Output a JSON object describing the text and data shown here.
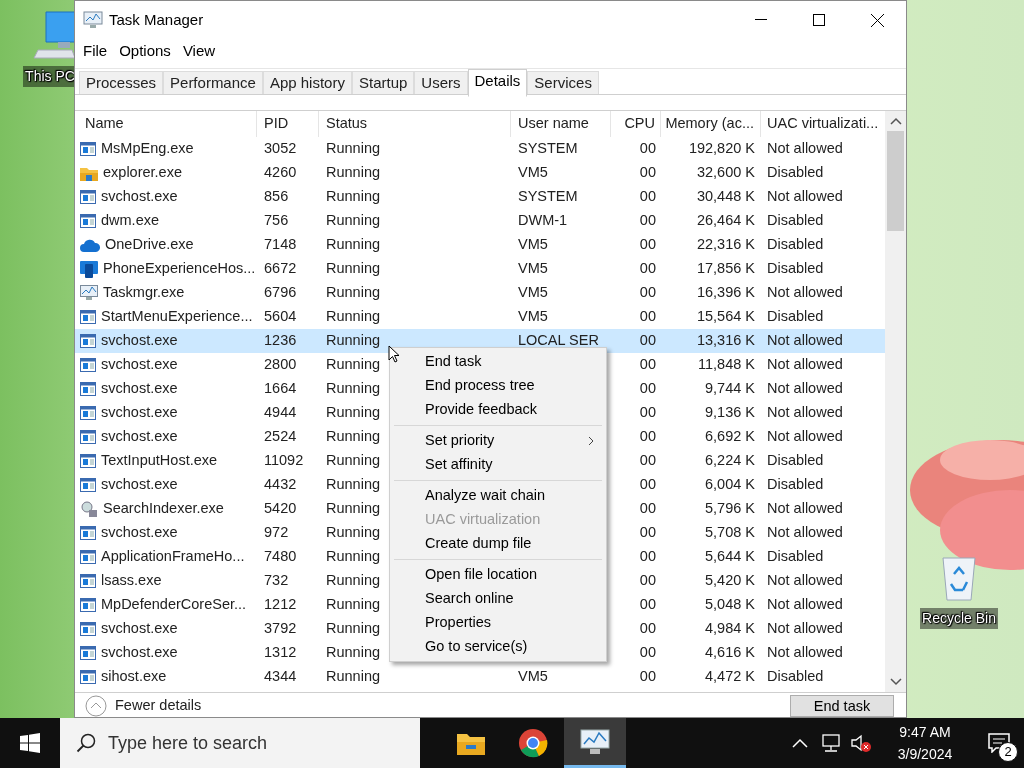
{
  "desktop_icons": [
    {
      "label": "This PC",
      "kind": "computer"
    },
    {
      "label": "Recycle Bin",
      "kind": "bin"
    }
  ],
  "window": {
    "title": "Task Manager"
  },
  "menu_bar": [
    "File",
    "Options",
    "View"
  ],
  "tabs": [
    {
      "label": "Processes",
      "selected": false
    },
    {
      "label": "Performance",
      "selected": false
    },
    {
      "label": "App history",
      "selected": false
    },
    {
      "label": "Startup",
      "selected": false
    },
    {
      "label": "Users",
      "selected": false
    },
    {
      "label": "Details",
      "selected": true
    },
    {
      "label": "Services",
      "selected": false
    }
  ],
  "table": {
    "columns": [
      "Name",
      "PID",
      "Status",
      "User name",
      "CPU",
      "Memory (ac...",
      "UAC virtualizati..."
    ],
    "rows": [
      {
        "kind": "app",
        "name": "MsMpEng.exe",
        "pid": "3052",
        "status": "Running",
        "user": "SYSTEM",
        "cpu": "00",
        "memory": "192,820 K",
        "uac": "Not allowed",
        "selected": false
      },
      {
        "kind": "folder",
        "name": "explorer.exe",
        "pid": "4260",
        "status": "Running",
        "user": "VM5",
        "cpu": "00",
        "memory": "32,600 K",
        "uac": "Disabled",
        "selected": false
      },
      {
        "kind": "app",
        "name": "svchost.exe",
        "pid": "856",
        "status": "Running",
        "user": "SYSTEM",
        "cpu": "00",
        "memory": "30,448 K",
        "uac": "Not allowed",
        "selected": false
      },
      {
        "kind": "app",
        "name": "dwm.exe",
        "pid": "756",
        "status": "Running",
        "user": "DWM-1",
        "cpu": "00",
        "memory": "26,464 K",
        "uac": "Disabled",
        "selected": false
      },
      {
        "kind": "cloud",
        "name": "OneDrive.exe",
        "pid": "7148",
        "status": "Running",
        "user": "VM5",
        "cpu": "00",
        "memory": "22,316 K",
        "uac": "Disabled",
        "selected": false
      },
      {
        "kind": "phone",
        "name": "PhoneExperienceHos...",
        "pid": "6672",
        "status": "Running",
        "user": "VM5",
        "cpu": "00",
        "memory": "17,856 K",
        "uac": "Disabled",
        "selected": false
      },
      {
        "kind": "monitor",
        "name": "Taskmgr.exe",
        "pid": "6796",
        "status": "Running",
        "user": "VM5",
        "cpu": "00",
        "memory": "16,396 K",
        "uac": "Not allowed",
        "selected": false
      },
      {
        "kind": "app",
        "name": "StartMenuExperience...",
        "pid": "5604",
        "status": "Running",
        "user": "VM5",
        "cpu": "00",
        "memory": "15,564 K",
        "uac": "Disabled",
        "selected": false
      },
      {
        "kind": "app",
        "name": "svchost.exe",
        "pid": "1236",
        "status": "Running",
        "user": "LOCAL SER",
        "cpu": "00",
        "memory": "13,316 K",
        "uac": "Not allowed",
        "selected": true
      },
      {
        "kind": "app",
        "name": "svchost.exe",
        "pid": "2800",
        "status": "Running",
        "cpu": "00",
        "memory": "11,848 K",
        "uac": "Not allowed",
        "selected": false
      },
      {
        "kind": "app",
        "name": "svchost.exe",
        "pid": "1664",
        "status": "Running",
        "cpu": "00",
        "memory": "9,744 K",
        "uac": "Not allowed",
        "selected": false
      },
      {
        "kind": "app",
        "name": "svchost.exe",
        "pid": "4944",
        "status": "Running",
        "cpu": "00",
        "memory": "9,136 K",
        "uac": "Not allowed",
        "selected": false
      },
      {
        "kind": "app",
        "name": "svchost.exe",
        "pid": "2524",
        "status": "Running",
        "cpu": "00",
        "memory": "6,692 K",
        "uac": "Not allowed",
        "selected": false
      },
      {
        "kind": "app",
        "name": "TextInputHost.exe",
        "pid": "11092",
        "status": "Running",
        "cpu": "00",
        "memory": "6,224 K",
        "uac": "Disabled",
        "selected": false
      },
      {
        "kind": "app",
        "name": "svchost.exe",
        "pid": "4432",
        "status": "Running",
        "cpu": "00",
        "memory": "6,004 K",
        "uac": "Disabled",
        "selected": false
      },
      {
        "kind": "search",
        "name": "SearchIndexer.exe",
        "pid": "5420",
        "status": "Running",
        "cpu": "00",
        "memory": "5,796 K",
        "uac": "Not allowed",
        "selected": false
      },
      {
        "kind": "app",
        "name": "svchost.exe",
        "pid": "972",
        "status": "Running",
        "cpu": "00",
        "memory": "5,708 K",
        "uac": "Not allowed",
        "selected": false
      },
      {
        "kind": "app",
        "name": "ApplicationFrameHo...",
        "pid": "7480",
        "status": "Running",
        "cpu": "00",
        "memory": "5,644 K",
        "uac": "Disabled",
        "selected": false
      },
      {
        "kind": "app",
        "name": "lsass.exe",
        "pid": "732",
        "status": "Running",
        "cpu": "00",
        "memory": "5,420 K",
        "uac": "Not allowed",
        "selected": false
      },
      {
        "kind": "app",
        "name": "MpDefenderCoreSer...",
        "pid": "1212",
        "status": "Running",
        "cpu": "00",
        "memory": "5,048 K",
        "uac": "Not allowed",
        "selected": false
      },
      {
        "kind": "app",
        "name": "svchost.exe",
        "pid": "3792",
        "status": "Running",
        "cpu": "00",
        "memory": "4,984 K",
        "uac": "Not allowed",
        "selected": false
      },
      {
        "kind": "app",
        "name": "svchost.exe",
        "pid": "1312",
        "status": "Running",
        "cpu": "00",
        "memory": "4,616 K",
        "uac": "Not allowed",
        "selected": false
      },
      {
        "kind": "app",
        "name": "sihost.exe",
        "pid": "4344",
        "status": "Running",
        "user": "VM5",
        "cpu": "00",
        "memory": "4,472 K",
        "uac": "Disabled",
        "selected": false
      }
    ]
  },
  "context_menu": {
    "groups": [
      [
        {
          "label": "End task",
          "disabled": false,
          "submenu": false
        },
        {
          "label": "End process tree",
          "disabled": false,
          "submenu": false
        },
        {
          "label": "Provide feedback",
          "disabled": false,
          "submenu": false
        }
      ],
      [
        {
          "label": "Set priority",
          "disabled": false,
          "submenu": true
        },
        {
          "label": "Set affinity",
          "disabled": false,
          "submenu": false
        }
      ],
      [
        {
          "label": "Analyze wait chain",
          "disabled": false,
          "submenu": false
        },
        {
          "label": "UAC virtualization",
          "disabled": true,
          "submenu": false
        },
        {
          "label": "Create dump file",
          "disabled": false,
          "submenu": false
        }
      ],
      [
        {
          "label": "Open file location",
          "disabled": false,
          "submenu": false
        },
        {
          "label": "Search online",
          "disabled": false,
          "submenu": false
        },
        {
          "label": "Properties",
          "disabled": false,
          "submenu": false
        },
        {
          "label": "Go to service(s)",
          "disabled": false,
          "submenu": false
        }
      ]
    ]
  },
  "footer": {
    "fewer_details": "Fewer details",
    "end_task": "End task"
  },
  "taskbar": {
    "search": {
      "placeholder": "Type here to search"
    },
    "apps": [
      {
        "kind": "folder",
        "selected": false
      },
      {
        "kind": "browser",
        "selected": false
      },
      {
        "kind": "monitor",
        "selected": true
      }
    ],
    "time": "9:47 AM",
    "date": "3/9/2024",
    "notifications": "2"
  }
}
